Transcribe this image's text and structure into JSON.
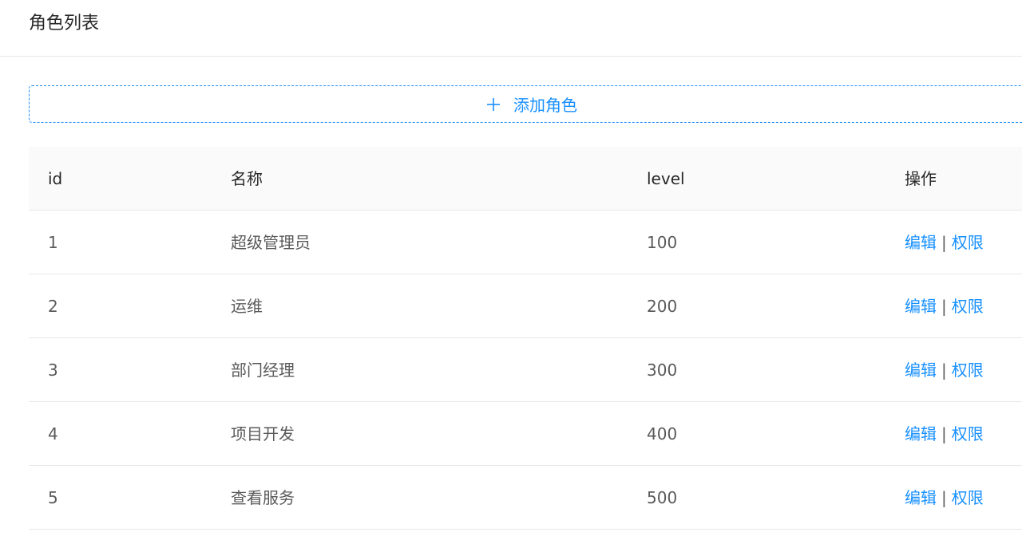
{
  "header": {
    "title": "角色列表"
  },
  "add_button": {
    "label": "添加角色",
    "icon": "plus-icon"
  },
  "table": {
    "columns": [
      "id",
      "名称",
      "level",
      "操作"
    ],
    "rows": [
      {
        "id": "1",
        "name": "超级管理员",
        "level": "100"
      },
      {
        "id": "2",
        "name": "运维",
        "level": "200"
      },
      {
        "id": "3",
        "name": "部门经理",
        "level": "300"
      },
      {
        "id": "4",
        "name": "项目开发",
        "level": "400"
      },
      {
        "id": "5",
        "name": "查看服务",
        "level": "500"
      }
    ],
    "actions": {
      "edit": "编辑",
      "separator": "|",
      "permission": "权限"
    }
  },
  "colors": {
    "primary": "#1890ff",
    "border": "#e8e8e8",
    "header_bg": "#fafafa"
  }
}
